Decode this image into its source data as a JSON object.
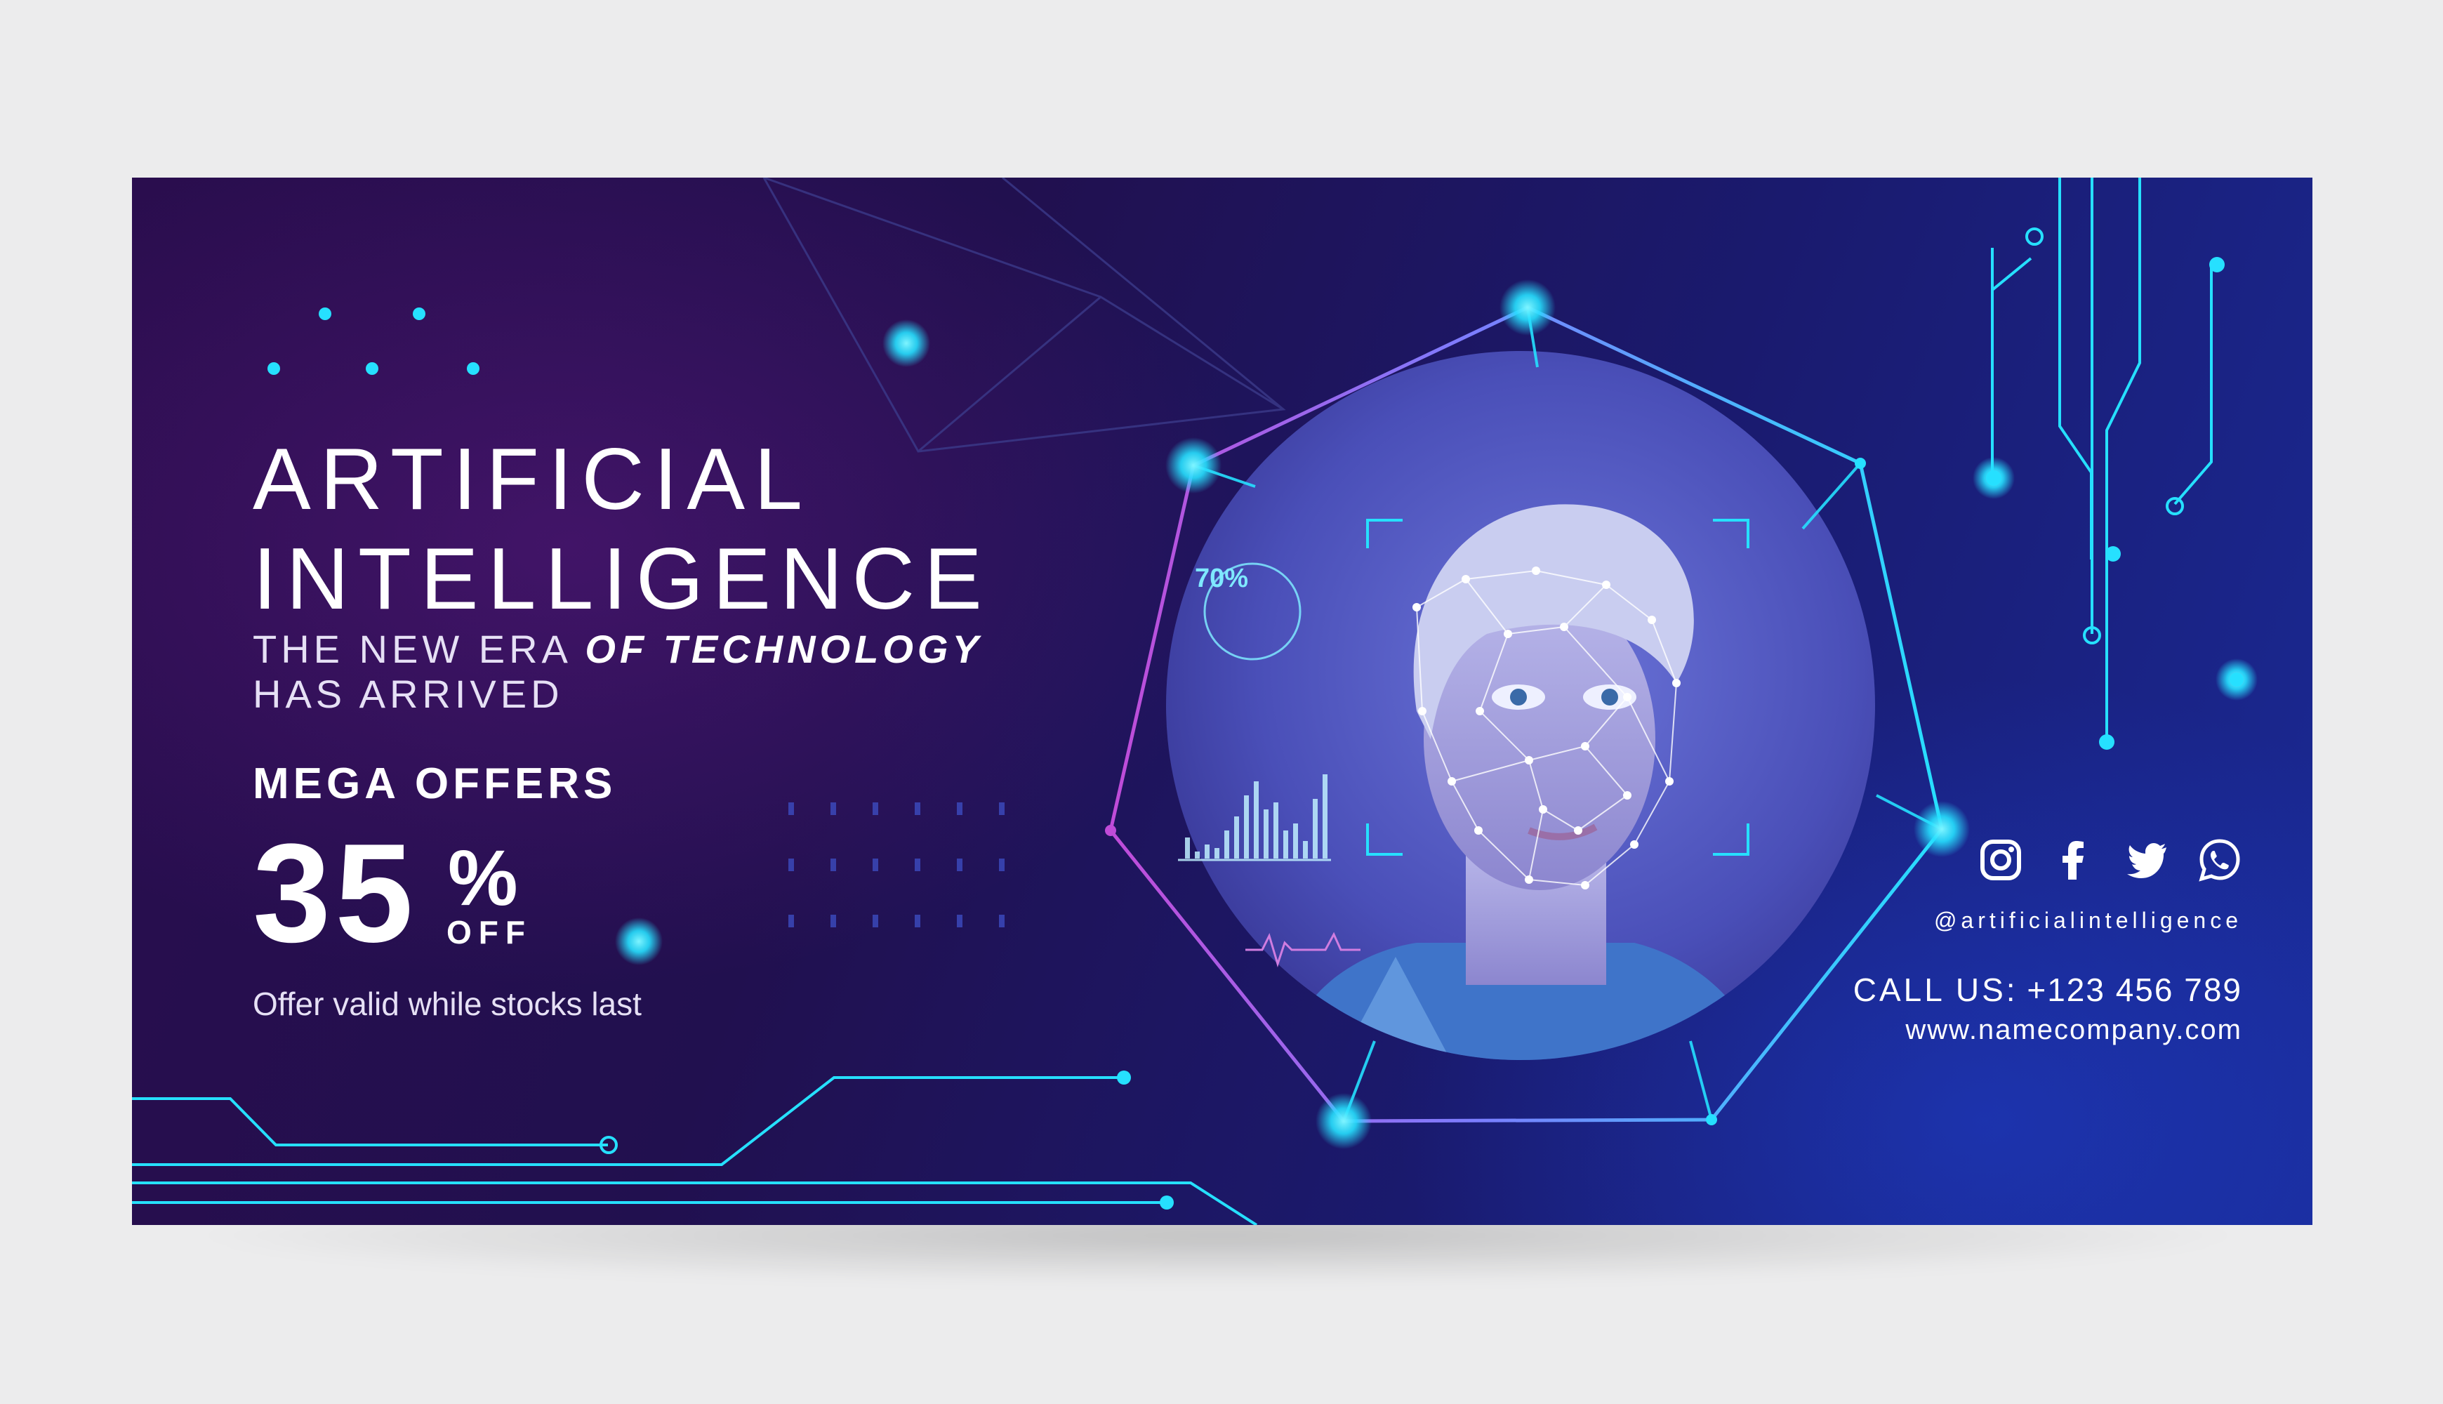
{
  "banner": {
    "title_line1": "ARTIFICIAL",
    "title_line2": "INTELLIGENCE",
    "subtitle_part1": "THE NEW ERA ",
    "subtitle_part2": "OF TECHNOLOGY",
    "subtitle_line2": "HAS ARRIVED",
    "offer_heading": "MEGA OFFERS",
    "discount_value": "35",
    "discount_percent": "%",
    "discount_off": "OFF",
    "offer_note": "Offer valid while stocks last",
    "scan_percent": "70%"
  },
  "contact": {
    "handle": "@artificialintelligence",
    "call_label": "CALL US",
    "call_number": ": +123 456 789",
    "website": "www.namecompany.com"
  },
  "social_icons": [
    "instagram-icon",
    "facebook-icon",
    "twitter-icon",
    "whatsapp-icon"
  ],
  "colors": {
    "accent_cyan": "#26e0ff",
    "accent_pink": "#c04bd8",
    "background_dark": "#21104f",
    "background_blue": "#1a2a96",
    "text": "#ffffff"
  }
}
